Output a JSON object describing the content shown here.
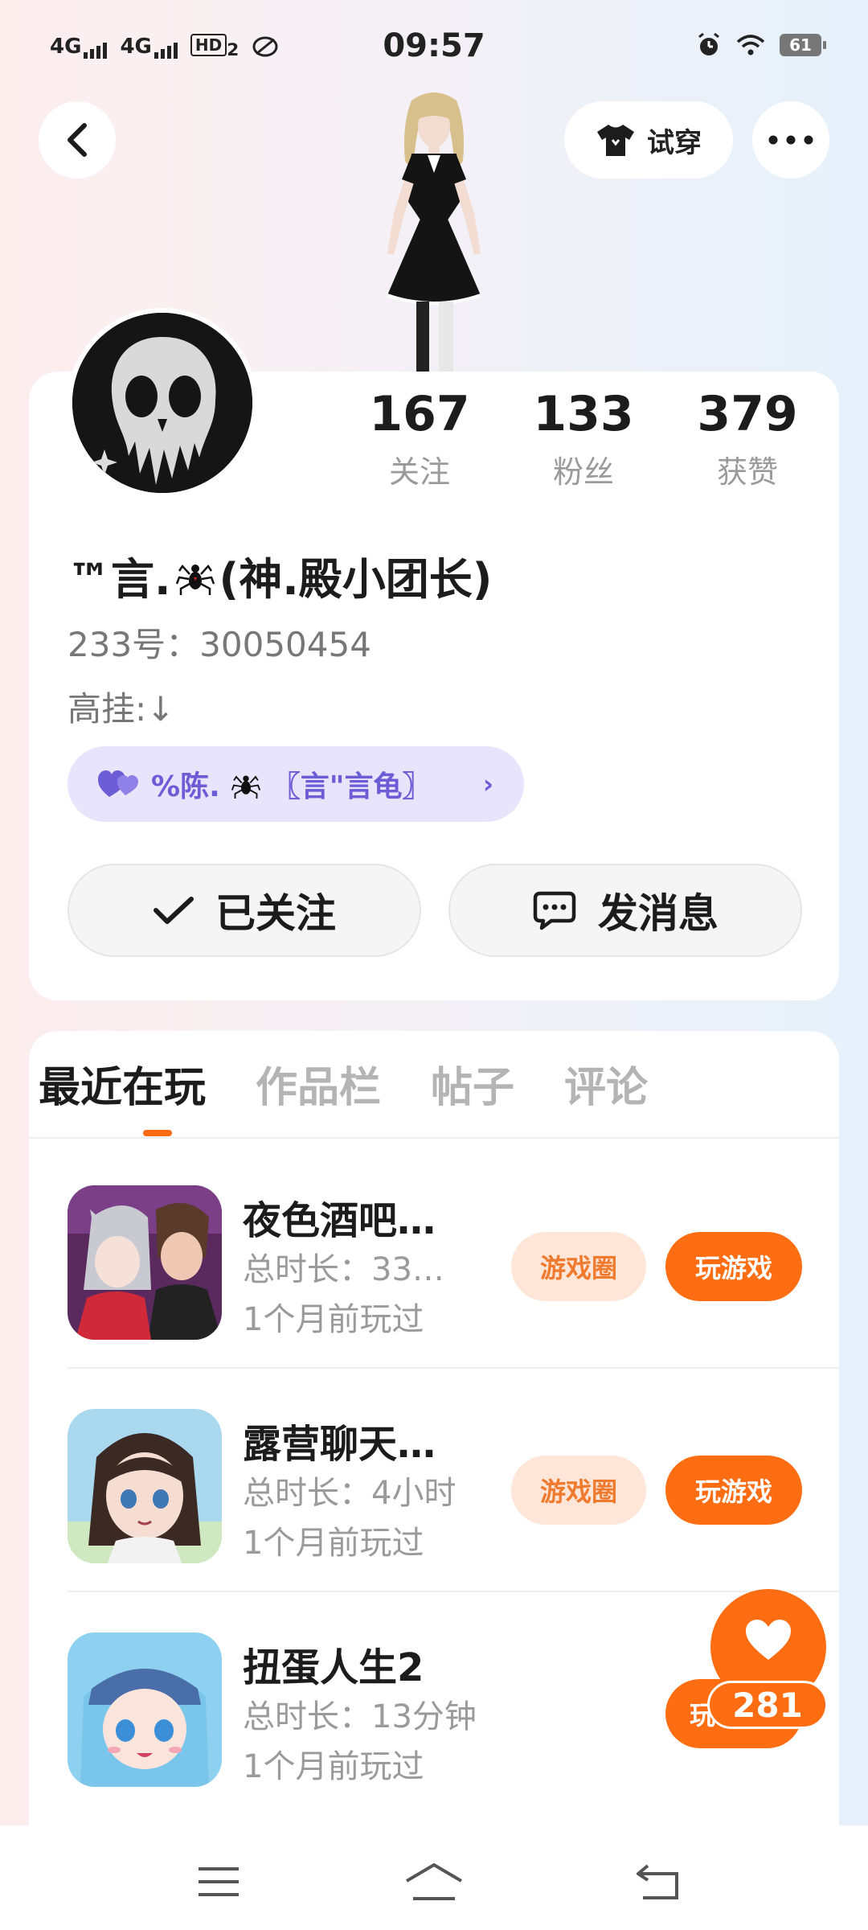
{
  "status_bar": {
    "net1": "4G",
    "net2": "4G",
    "hd": "HD",
    "hd_sub": "2",
    "time": "09:57",
    "battery": "61"
  },
  "header": {
    "try_on_label": "试穿"
  },
  "profile": {
    "stats": [
      {
        "value": "167",
        "label": "关注"
      },
      {
        "value": "133",
        "label": "粉丝"
      },
      {
        "value": "379",
        "label": "获赞"
      }
    ],
    "name_prefix": "™言.",
    "name_suffix": "(神.殿小团长)",
    "uid": "233号：30050454",
    "bio": "高挂:↓",
    "tag_prefix": "%陈.",
    "tag_suffix": "〖言\"言龟〗",
    "follow_label": "已关注",
    "message_label": "发消息"
  },
  "tabs": [
    "最近在玩",
    "作品栏",
    "帖子",
    "评论"
  ],
  "games": [
    {
      "title": "夜色酒吧…",
      "duration": "总时长：33…",
      "last": "1个月前玩过",
      "circle_label": "游戏圈",
      "play_label": "玩游戏"
    },
    {
      "title": "露营聊天…",
      "duration": "总时长：4小时",
      "last": "1个月前玩过",
      "circle_label": "游戏圈",
      "play_label": "玩游戏"
    },
    {
      "title": "扭蛋人生2",
      "duration": "总时长：13分钟",
      "last": "1个月前玩过",
      "play_label": "玩"
    }
  ],
  "like_float": {
    "count": "281"
  },
  "colors": {
    "accent": "#ff6d12",
    "tag_bg": "#e8e4fc",
    "tag_text": "#6c5cd6"
  }
}
